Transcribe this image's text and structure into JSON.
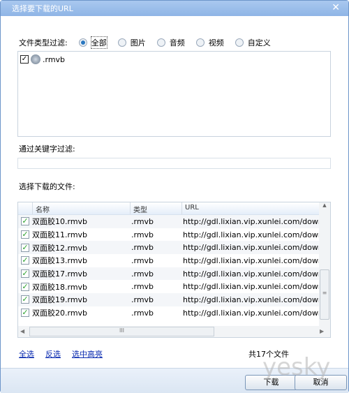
{
  "window": {
    "title": "选择要下载的URL",
    "close_icon": "close-icon"
  },
  "type_filter": {
    "label": "文件类型过滤:",
    "options": [
      "全部",
      "图片",
      "音频",
      "视频",
      "自定义"
    ],
    "selected": "全部"
  },
  "types": [
    {
      "name": ".rmvb",
      "checked": true,
      "icon": "rm-file-icon"
    }
  ],
  "keyword": {
    "label": "通过关键字过滤:",
    "value": ""
  },
  "files": {
    "label": "选择下载的文件:",
    "columns": [
      "名称",
      "类型",
      "URL"
    ],
    "rows": [
      {
        "name": "双面胶10.rmvb",
        "type": ".rmvb",
        "url": "http://gdl.lixian.vip.xunlei.com/downl",
        "checked": true
      },
      {
        "name": "双面胶11.rmvb",
        "type": ".rmvb",
        "url": "http://gdl.lixian.vip.xunlei.com/downl",
        "checked": true
      },
      {
        "name": "双面胶12.rmvb",
        "type": ".rmvb",
        "url": "http://gdl.lixian.vip.xunlei.com/downl",
        "checked": true
      },
      {
        "name": "双面胶13.rmvb",
        "type": ".rmvb",
        "url": "http://gdl.lixian.vip.xunlei.com/downl",
        "checked": true
      },
      {
        "name": "双面胶17.rmvb",
        "type": ".rmvb",
        "url": "http://gdl.lixian.vip.xunlei.com/downl",
        "checked": true
      },
      {
        "name": "双面胶18.rmvb",
        "type": ".rmvb",
        "url": "http://gdl.lixian.vip.xunlei.com/downl",
        "checked": true
      },
      {
        "name": "双面胶19.rmvb",
        "type": ".rmvb",
        "url": "http://gdl.lixian.vip.xunlei.com/downl",
        "checked": true
      },
      {
        "name": "双面胶20.rmvb",
        "type": ".rmvb",
        "url": "http://gdl.lixian.vip.xunlei.com/downl",
        "checked": true
      }
    ]
  },
  "links": {
    "select_all": "全选",
    "invert": "反选",
    "highlight": "选中高亮"
  },
  "count": "共17个文件",
  "buttons": {
    "download": "下载",
    "cancel": "取消"
  },
  "watermark": "yesky 天极网"
}
